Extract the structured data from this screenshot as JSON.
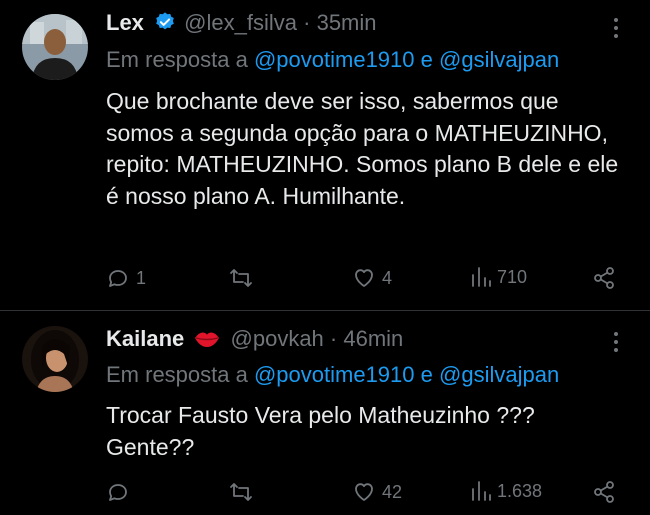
{
  "tweets": [
    {
      "name": "Lex",
      "handle": "@lex_fsilva",
      "separator": "·",
      "time": "35min",
      "reply_prefix": "Em resposta a",
      "mention1": "@povotime1910",
      "conj": "e",
      "mention2": "@gsilvajpan",
      "text": "Que brochante deve ser isso, sabermos que somos a segunda opção para o MATHEUZINHO, repito: MATHEUZINHO. Somos plano B dele e ele é nosso plano A. Humilhante.",
      "replies": "1",
      "likes": "4",
      "views": "710",
      "verified": true
    },
    {
      "name": "Kailane",
      "handle": "@povkah",
      "separator": "·",
      "time": "46min",
      "reply_prefix": "Em resposta a",
      "mention1": "@povotime1910",
      "conj": "e",
      "mention2": "@gsilvajpan",
      "text": "Trocar Fausto Vera pelo Matheuzinho ??? Gente??",
      "replies": "",
      "likes": "42",
      "views": "1.638",
      "emoji": "lips-icon"
    }
  ],
  "colors": {
    "accent": "#1d9bf0",
    "muted": "#71767b",
    "text": "#e7e9ea",
    "background": "#000000"
  }
}
